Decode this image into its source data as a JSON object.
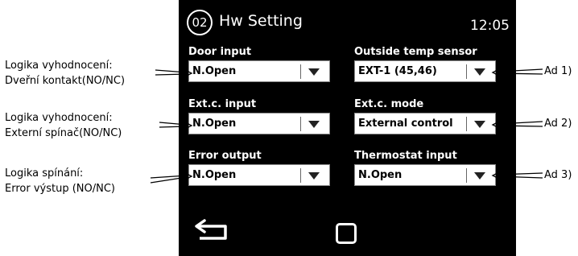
{
  "header": {
    "badge": "02",
    "title": "Hw Setting",
    "time": "12:05"
  },
  "left_fields": [
    {
      "label": "Door input",
      "value": "N.Open"
    },
    {
      "label": "Ext.c. input",
      "value": "N.Open"
    },
    {
      "label": "Error output",
      "value": "N.Open"
    }
  ],
  "right_fields": [
    {
      "label": "Outside temp sensor",
      "value": "EXT-1 (45,46)"
    },
    {
      "label": "Ext.c. mode",
      "value": "External control"
    },
    {
      "label": "Thermostat input",
      "value": "N.Open"
    }
  ],
  "annotations_left": [
    {
      "line1": "Logika vyhodnocení:",
      "line2": "Dveřní kontakt(NO/NC)"
    },
    {
      "line1": "Logika vyhodnocení:",
      "line2": "Externí spínač(NO/NC)"
    },
    {
      "line1": "Logika spínání:",
      "line2": "Error výstup (NO/NC)"
    }
  ],
  "annotations_right": [
    "Ad 1)",
    "Ad 2)",
    "Ad 3)"
  ],
  "footer": {
    "back_icon": "back-arrow-icon",
    "home_icon": "home-square-icon"
  }
}
